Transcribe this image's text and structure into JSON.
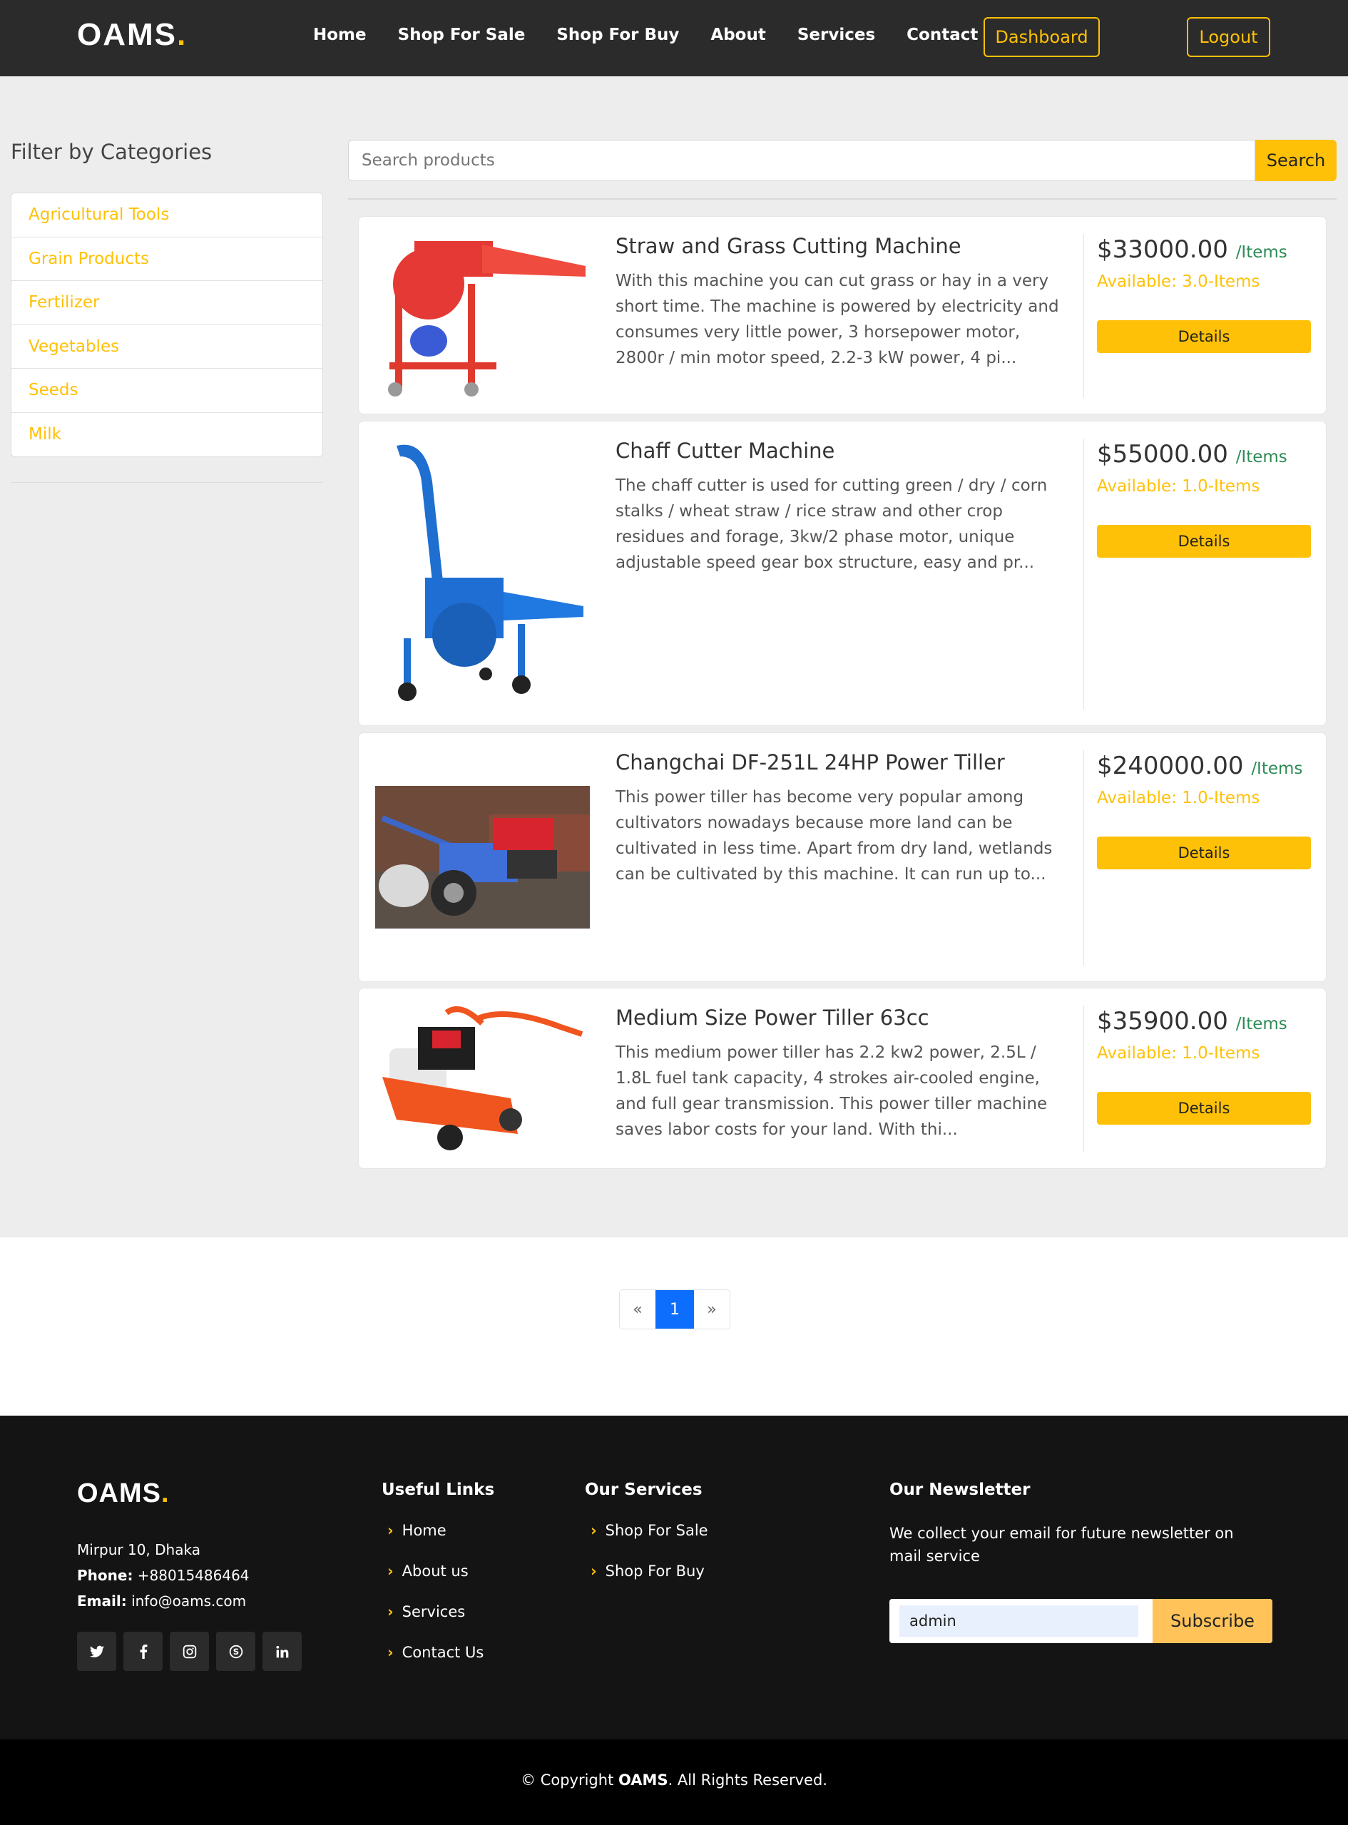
{
  "header": {
    "logo": "OAMS",
    "logo_dot": ".",
    "nav": [
      "Home",
      "Shop For Sale",
      "Shop For Buy",
      "About",
      "Services",
      "Contact"
    ],
    "dashboard_label": "Dashboard",
    "logout_label": "Logout"
  },
  "sidebar": {
    "title": "Filter by Categories",
    "categories": [
      "Agricultural Tools",
      "Grain Products",
      "Fertilizer",
      "Vegetables",
      "Seeds",
      "Milk"
    ]
  },
  "search": {
    "placeholder": "Search products",
    "button_label": "Search"
  },
  "products": [
    {
      "title": "Straw and Grass Cutting Machine",
      "description": "With this machine you can cut grass or hay in a very short time. The machine is powered by electricity and consumes very little power, 3 horsepower motor, 2800r / min motor speed, 2.2-3 kW power, 4 pi...",
      "price": "$33000.00",
      "unit": "/Items",
      "availability": "Available: 3.0-Items",
      "details_label": "Details"
    },
    {
      "title": "Chaff Cutter Machine",
      "description": "The chaff cutter is used for cutting green / dry / corn stalks / wheat straw / rice straw and other crop residues and forage, 3kw/2 phase motor, unique adjustable speed gear box structure, easy and pr...",
      "price": "$55000.00",
      "unit": "/Items",
      "availability": "Available: 1.0-Items",
      "details_label": "Details"
    },
    {
      "title": "Changchai DF-251L 24HP Power Tiller",
      "description": "This power tiller has become very popular among cultivators nowadays because more land can be cultivated in less time. Apart from dry land, wetlands can be cultivated by this machine. It can run up to...",
      "price": "$240000.00",
      "unit": "/Items",
      "availability": "Available: 1.0-Items",
      "details_label": "Details"
    },
    {
      "title": "Medium Size Power Tiller 63cc",
      "description": "This medium power tiller has 2.2 kw2 power, 2.5L / 1.8L fuel tank capacity, 4 strokes air-cooled engine, and full gear transmission. This power tiller machine saves labor costs for your land. With thi...",
      "price": "$35900.00",
      "unit": "/Items",
      "availability": "Available: 1.0-Items",
      "details_label": "Details"
    }
  ],
  "pagination": {
    "prev": "«",
    "current": "1",
    "next": "»"
  },
  "footer": {
    "logo": "OAMS",
    "logo_dot": ".",
    "address": "Mirpur 10, Dhaka",
    "phone_label": "Phone:",
    "phone": "+88015486464",
    "email_label": "Email:",
    "email": "info@oams.com",
    "social_icons": [
      "twitter-icon",
      "facebook-icon",
      "instagram-icon",
      "skype-icon",
      "linkedin-icon"
    ],
    "social_glyphs": [
      "🐦",
      "f",
      "◎",
      "S",
      "in"
    ],
    "useful_links_title": "Useful Links",
    "useful_links": [
      "Home",
      "About us",
      "Services",
      "Contact Us"
    ],
    "services_title": "Our Services",
    "services": [
      "Shop For Sale",
      "Shop For Buy"
    ],
    "newsletter_title": "Our Newsletter",
    "newsletter_text": "We collect your email for future newsletter on mail service",
    "newsletter_value": "admin",
    "subscribe_label": "Subscribe",
    "copyright_prefix": "© Copyright",
    "copyright_brand": "OAMS",
    "copyright_suffix": ". All Rights Reserved."
  },
  "colors": {
    "accent": "#ffc107",
    "header_bg": "#2b2b2b",
    "footer_bg": "#141414",
    "price_unit": "#2e8b57",
    "pagination_active": "#0d6efd"
  }
}
